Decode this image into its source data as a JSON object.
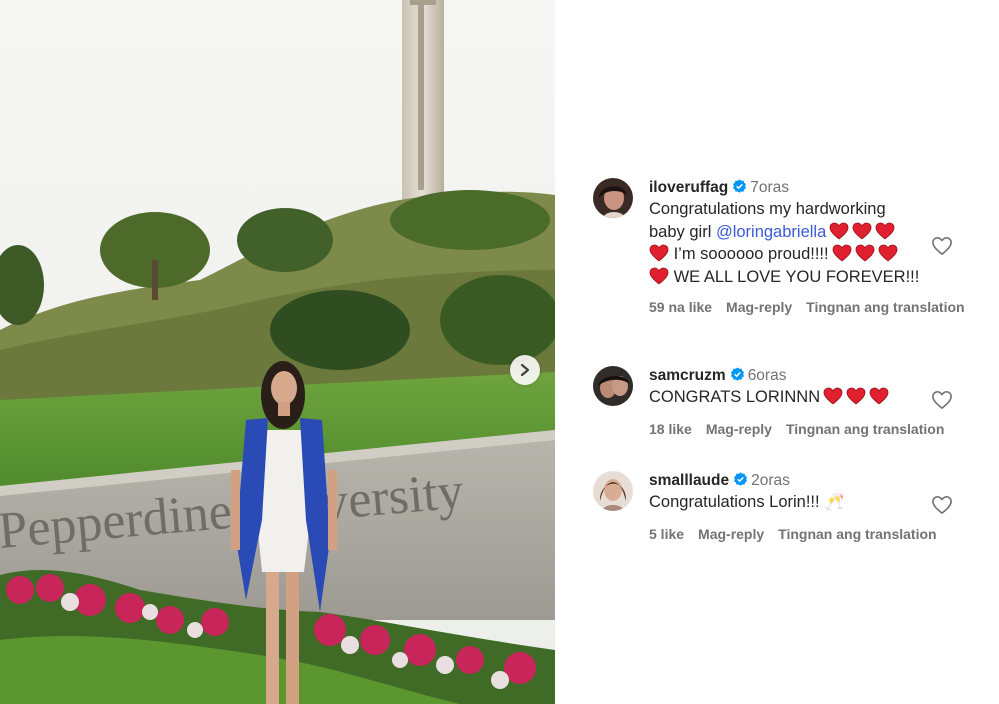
{
  "post_image": {
    "carousel_next_label": "Next",
    "sign_text": "Pepperdine University"
  },
  "comments": [
    {
      "username": "iloveruffag",
      "time": "7oras",
      "text_line1": "Congratulations my hardworking",
      "text_line2_prefix": "baby girl ",
      "mention": "@loringabriella",
      "text_line3": " I’m soooooo proud!!!!",
      "text_line4": " WE ALL LOVE YOU FOREVER!!!",
      "likes": "59 na like",
      "reply_label": "Mag-reply",
      "translation_label": "Tingnan ang translation"
    },
    {
      "username": "samcruzm",
      "time": "6oras",
      "text": "CONGRATS LORINNN",
      "likes": "18 like",
      "reply_label": "Mag-reply",
      "translation_label": "Tingnan ang translation"
    },
    {
      "username": "smalllaude",
      "time": "2oras",
      "text": "Congratulations Lorin!!! 🥂",
      "likes": "5 like",
      "reply_label": "Mag-reply",
      "translation_label": "Tingnan ang translation"
    }
  ],
  "colors": {
    "verified": "#0095f6",
    "heart_emoji": "#e0202e",
    "mention": "#3b5bd8",
    "meta_text": "#737373"
  },
  "icons": {
    "verified": "verified-badge-icon",
    "like": "heart-outline-icon",
    "next": "chevron-right-icon"
  }
}
